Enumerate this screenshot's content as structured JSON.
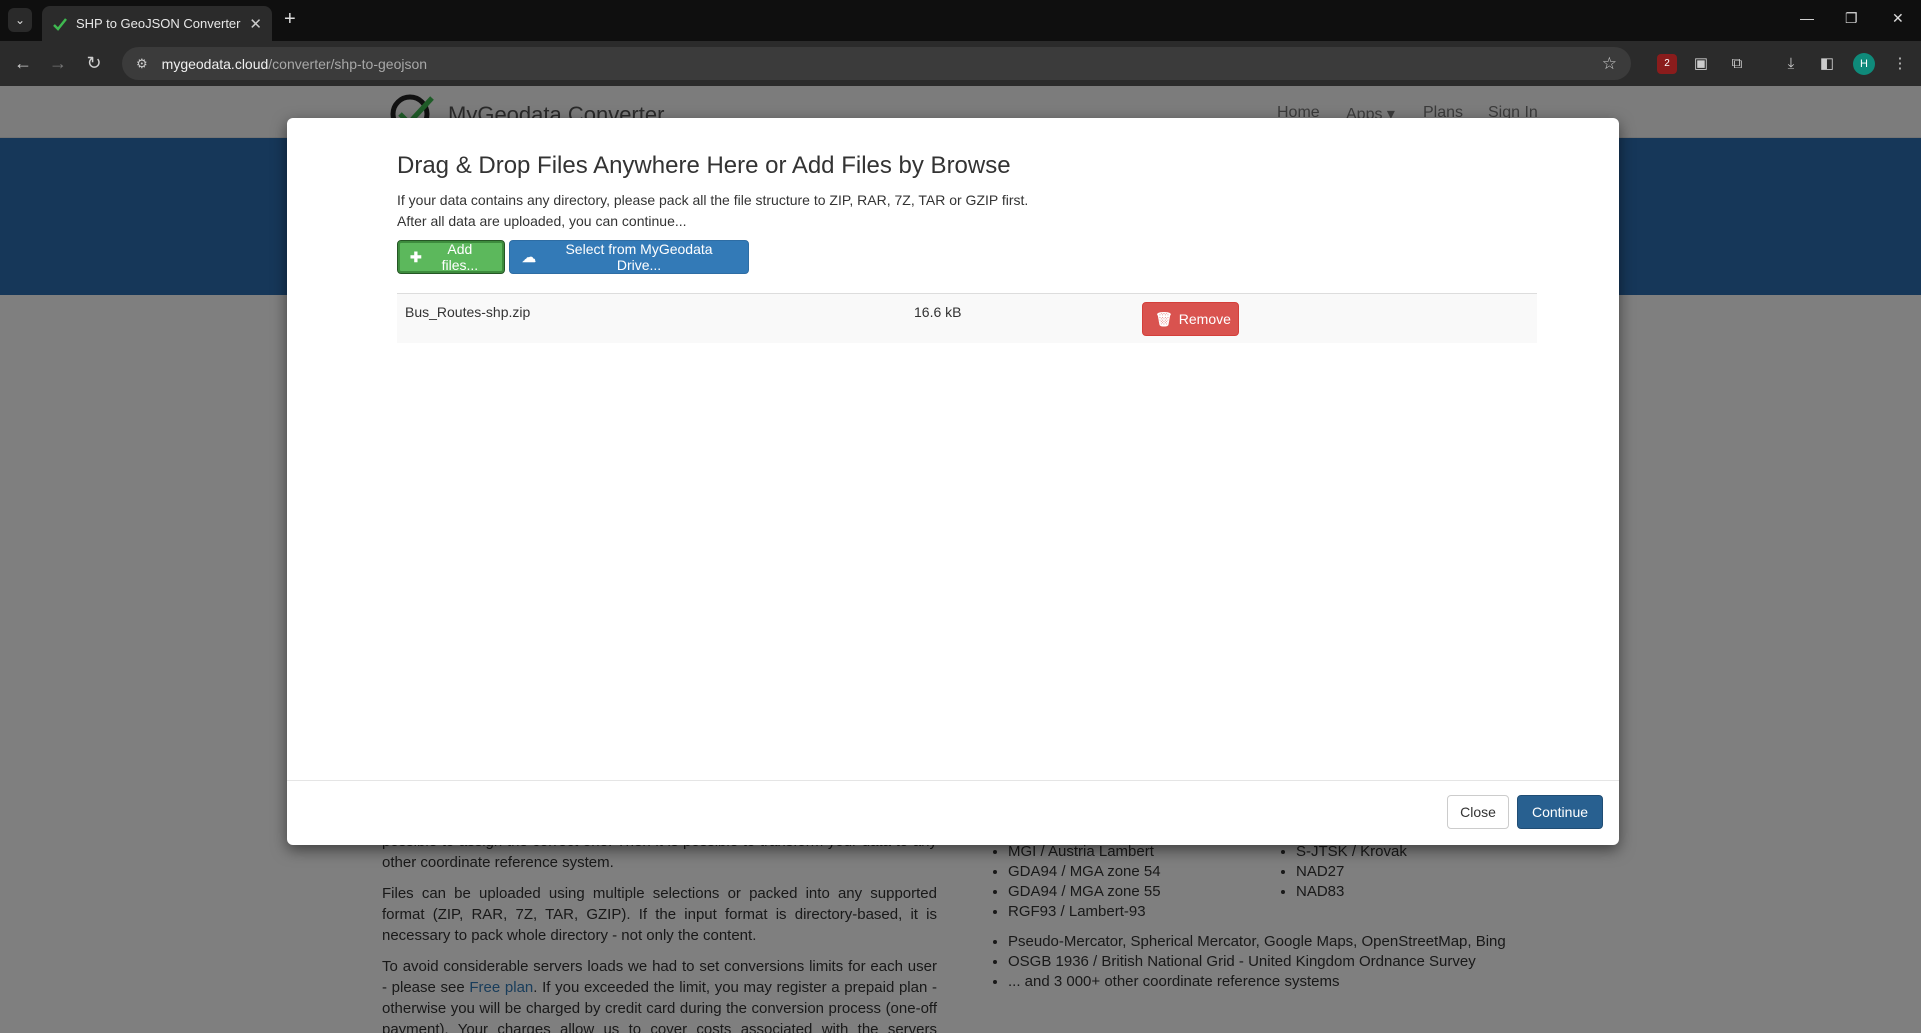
{
  "browser": {
    "tab_title": "SHP to GeoJSON Converter Onl",
    "url_host": "mygeodata.cloud",
    "url_path": "/converter/shp-to-geojson",
    "extension_badge": "2",
    "profile_initial": "H"
  },
  "site": {
    "brand": "MyGeodata Converter",
    "nav": [
      "Home",
      "Apps ▾",
      "Plans",
      "Sign In"
    ]
  },
  "background_text": {
    "para1_partial": "possible to assign the correct one. Then it is possible to transform your data to any other coordinate reference system.",
    "para2": "Files can be uploaded using multiple selections or packed into any supported format (ZIP, RAR, 7Z, TAR, GZIP). If the input format is directory-based, it is necessary to pack whole directory - not only the content.",
    "para3_a": "To avoid considerable servers loads we had to set conversions limits for each user - please see ",
    "para3_link": "Free plan",
    "para3_b": ". If you exceeded the limit, you may register a prepaid plan - otherwise you will be charged by credit card during the conversion process (one-off payment). Your charges allow us to cover costs associated with the servers operation.",
    "crs_left": [
      "MGI / Austria Lambert",
      "GDA94 / MGA zone 54",
      "GDA94 / MGA zone 55",
      "RGF93 / Lambert-93"
    ],
    "crs_right": [
      "S-JTSK / Krovak",
      "NAD27",
      "NAD83"
    ],
    "crs_more": [
      "Pseudo-Mercator, Spherical Mercator, Google Maps, OpenStreetMap, Bing",
      "OSGB 1936 / British National Grid - United Kingdom Ordnance Survey",
      "... and 3 000+ other coordinate reference systems"
    ]
  },
  "modal": {
    "title": "Drag & Drop Files Anywhere Here or Add Files by Browse",
    "info_line1": "If your data contains any directory, please pack all the file structure to ZIP, RAR, 7Z, TAR or GZIP first.",
    "info_line2": "After all data are uploaded, you can continue...",
    "add_files_label": "Add files...",
    "drive_label": "Select from MyGeodata Drive...",
    "files": [
      {
        "name": "Bus_Routes-shp.zip",
        "size": "16.6 kB",
        "remove_label": "Remove"
      }
    ],
    "close_label": "Close",
    "continue_label": "Continue"
  },
  "colors": {
    "success": "#5cb85c",
    "primary": "#337ab7",
    "danger": "#d9534f",
    "hero": "#2d6fb3"
  }
}
